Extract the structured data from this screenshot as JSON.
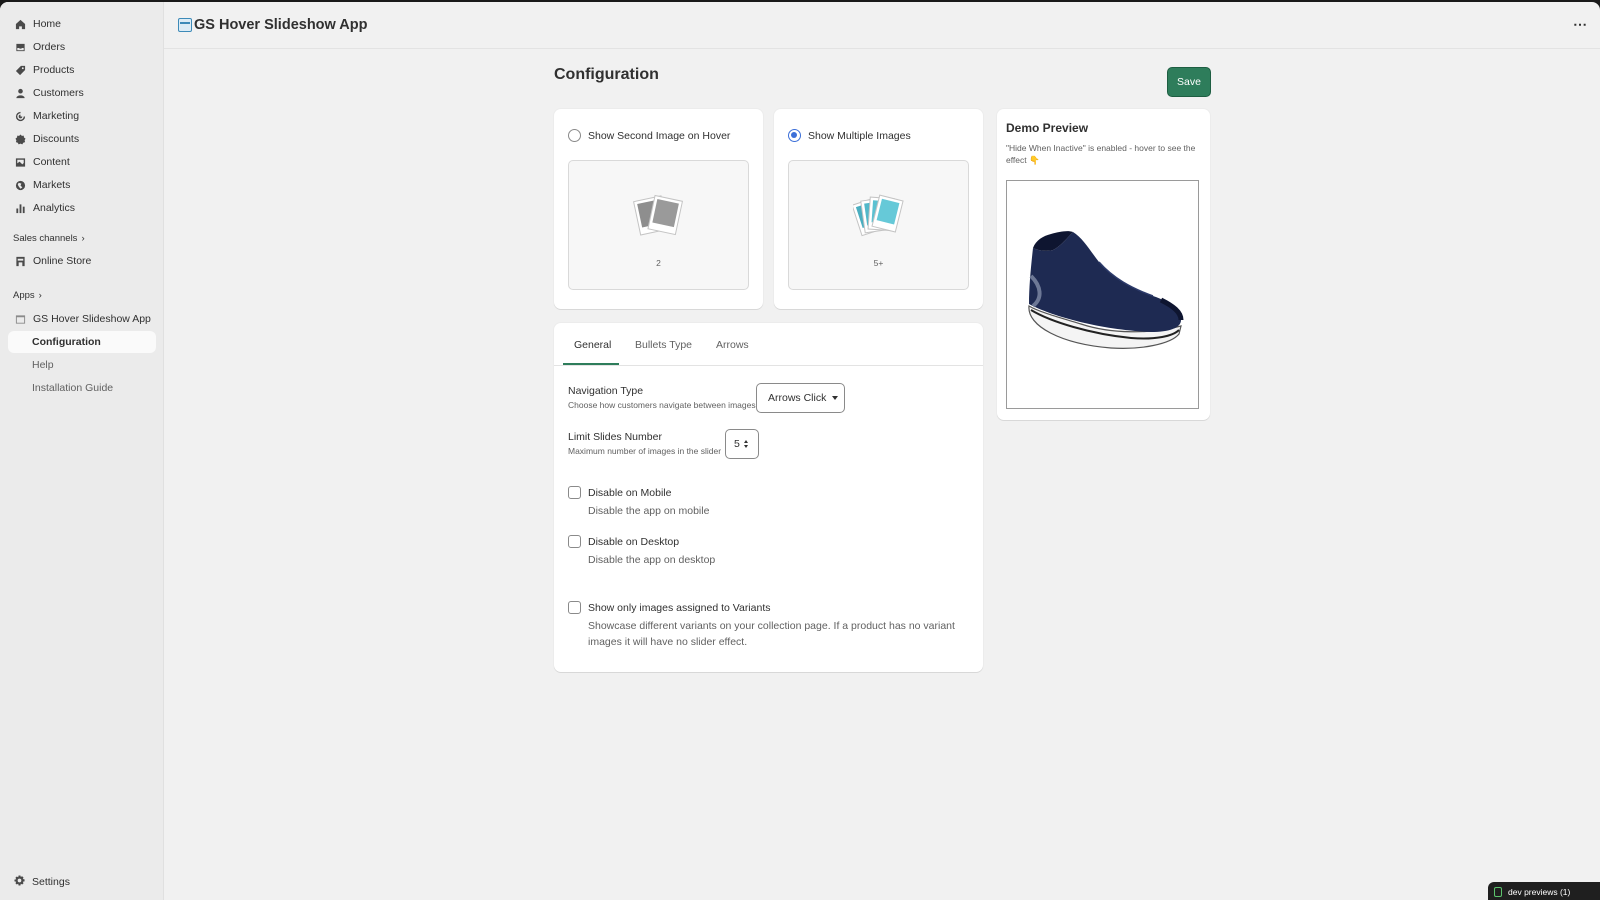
{
  "app_title": "GS Hover Slideshow App",
  "more_icon": "⋯",
  "sidebar": {
    "items": [
      {
        "label": "Home",
        "icon": "home-icon"
      },
      {
        "label": "Orders",
        "icon": "inbox-icon"
      },
      {
        "label": "Products",
        "icon": "tag-icon"
      },
      {
        "label": "Customers",
        "icon": "person-icon"
      },
      {
        "label": "Marketing",
        "icon": "target-icon"
      },
      {
        "label": "Discounts",
        "icon": "discount-icon"
      },
      {
        "label": "Content",
        "icon": "image-icon"
      },
      {
        "label": "Markets",
        "icon": "globe-icon"
      },
      {
        "label": "Analytics",
        "icon": "chart-icon"
      }
    ],
    "sales_channels_label": "Sales channels",
    "online_store": "Online Store",
    "apps_label": "Apps",
    "app_name": "GS Hover Slideshow App",
    "app_subitems": [
      "Configuration",
      "Help",
      "Installation Guide"
    ],
    "settings": "Settings",
    "chevron": "›"
  },
  "page": {
    "title": "Configuration",
    "save_label": "Save"
  },
  "options": [
    {
      "label": "Show Second Image on Hover",
      "count": "2",
      "selected": false
    },
    {
      "label": "Show Multiple Images",
      "count": "5+",
      "selected": true
    }
  ],
  "tabs": [
    "General",
    "Bullets Type",
    "Arrows"
  ],
  "general": {
    "nav_type_label": "Navigation Type",
    "nav_type_help": "Choose how customers navigate between images",
    "nav_type_value": "Arrows Click",
    "limit_label": "Limit Slides Number",
    "limit_help": "Maximum number of images in the slider",
    "limit_value": "5",
    "disable_mobile_label": "Disable on Mobile",
    "disable_mobile_help": "Disable the app on mobile",
    "disable_desktop_label": "Disable on Desktop",
    "disable_desktop_help": "Disable the app on desktop",
    "variants_label": "Show only images assigned to Variants",
    "variants_help": "Showcase different variants on your collection page. If a product has no variant images it will have no slider effect."
  },
  "preview": {
    "title": "Demo Preview",
    "note": "\"Hide When Inactive\" is enabled - hover to see the effect 👇"
  },
  "dev_badge": "dev previews (1)",
  "colors": {
    "accent": "#2e7d5b",
    "radio_selected": "#3c6fd8",
    "shoe": "#1e2a52"
  }
}
